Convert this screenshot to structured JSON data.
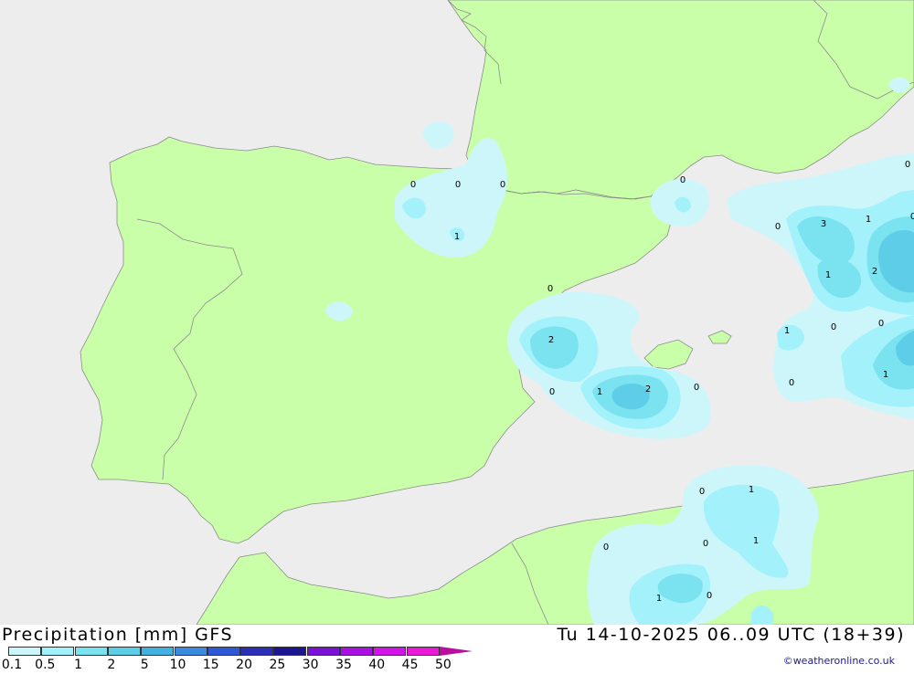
{
  "map": {
    "colors": {
      "sea": "#ededed",
      "land": "#c9ffa8",
      "border": "#8c8c8c",
      "precip_0_1": "#cdf6fb",
      "precip_0_5": "#a3f1fa",
      "precip_1": "#7be2f0",
      "precip_2": "#5dcde8"
    },
    "value_labels": [
      "0",
      "0",
      "0",
      "1",
      "0",
      "0",
      "2",
      "0",
      "1",
      "2",
      "0",
      "0",
      "3",
      "1",
      "1",
      "2",
      "0",
      "1",
      "0",
      "0",
      "0",
      "1",
      "0",
      "1",
      "0",
      "1",
      "0",
      "1",
      "0",
      "0"
    ]
  },
  "footer": {
    "title": "Precipitation [mm] GFS",
    "datetime": "Tu 14-10-2025 06..09 UTC (18+39)",
    "credit": "©weatheronline.co.uk"
  },
  "legend": {
    "ticks": [
      "0.1",
      "0.5",
      "1",
      "2",
      "5",
      "10",
      "15",
      "20",
      "25",
      "30",
      "35",
      "40",
      "45",
      "50"
    ],
    "colors": [
      "#cdf6fb",
      "#a3f1fa",
      "#7be2f0",
      "#5dcde8",
      "#43b0e0",
      "#3a8ae0",
      "#2f58d6",
      "#2a2fb5",
      "#1d1690",
      "#7a12d6",
      "#a812e0",
      "#d015e8",
      "#e81ad8",
      "#b8109c"
    ]
  }
}
